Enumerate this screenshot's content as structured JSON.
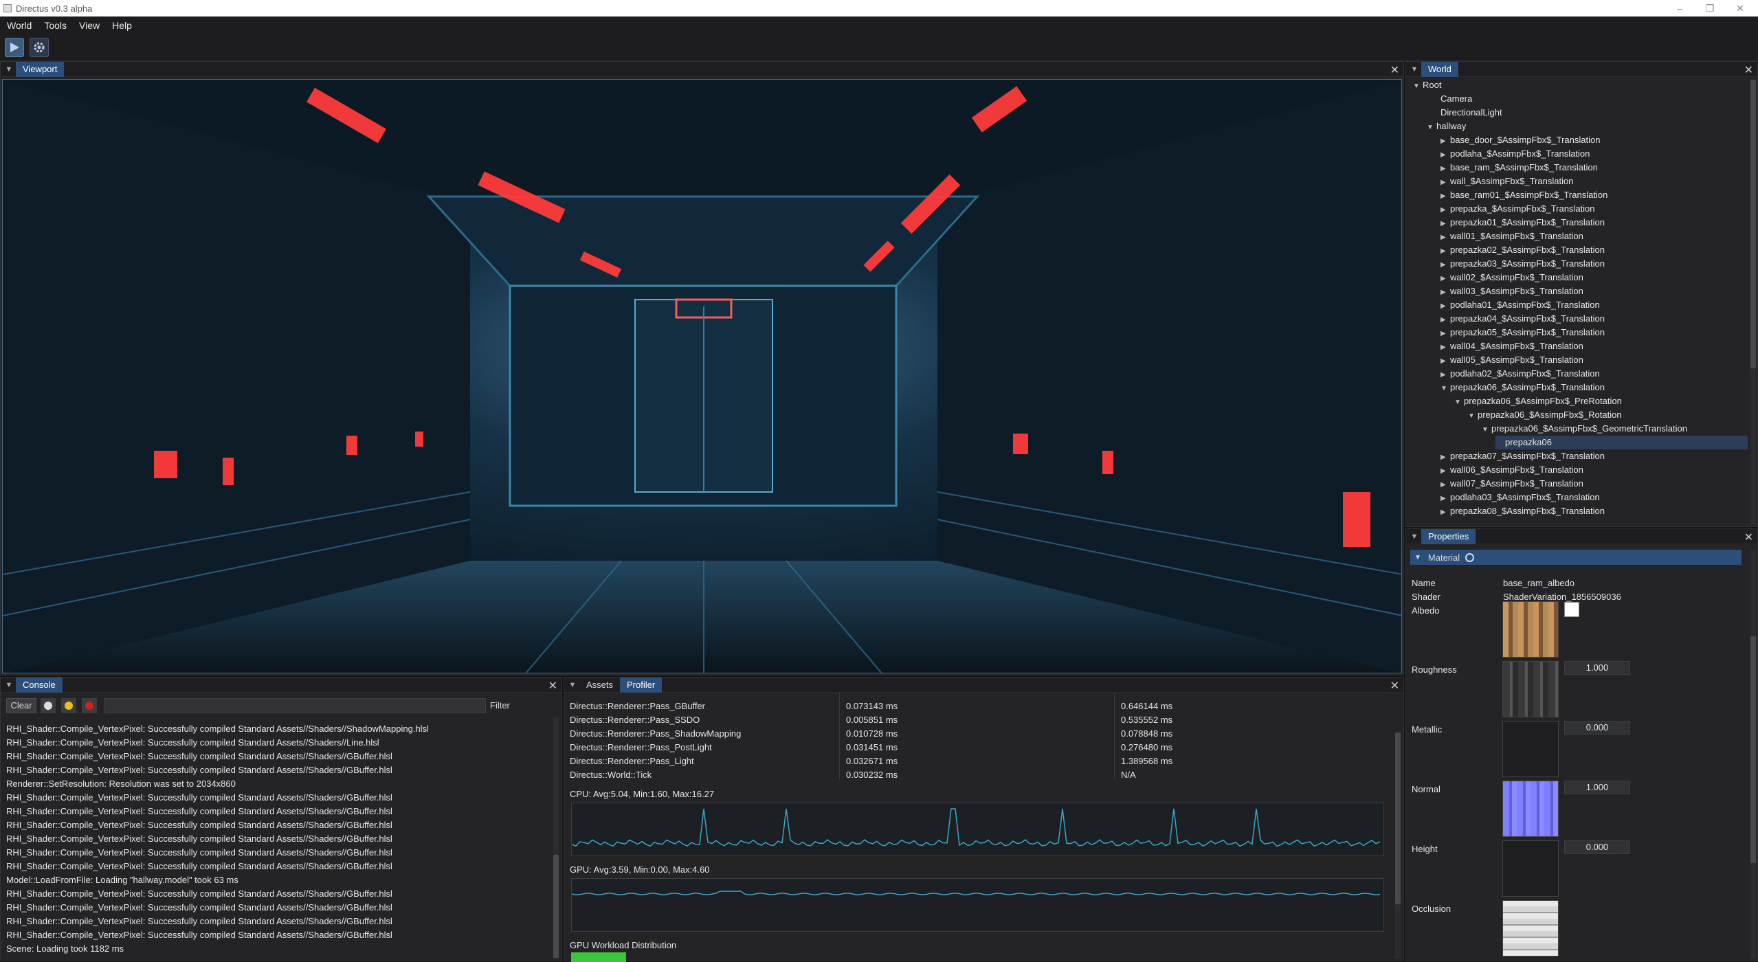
{
  "window": {
    "title": "Directus v0.3 alpha"
  },
  "menubar": {
    "items": [
      "World",
      "Tools",
      "View",
      "Help"
    ]
  },
  "viewport": {
    "tab": "Viewport"
  },
  "world": {
    "tab": "World",
    "nodes": [
      {
        "label": "Root",
        "arrow": "▼"
      },
      {
        "label": "Camera",
        "arrow": ""
      },
      {
        "label": "DirectionalLight",
        "arrow": ""
      },
      {
        "label": "hallway",
        "arrow": "▼"
      },
      {
        "label": "base_door_$AssimpFbx$_Translation",
        "arrow": "▶"
      },
      {
        "label": "podlaha_$AssimpFbx$_Translation",
        "arrow": "▶"
      },
      {
        "label": "base_ram_$AssimpFbx$_Translation",
        "arrow": "▶"
      },
      {
        "label": "wall_$AssimpFbx$_Translation",
        "arrow": "▶"
      },
      {
        "label": "base_ram01_$AssimpFbx$_Translation",
        "arrow": "▶"
      },
      {
        "label": "prepazka_$AssimpFbx$_Translation",
        "arrow": "▶"
      },
      {
        "label": "prepazka01_$AssimpFbx$_Translation",
        "arrow": "▶"
      },
      {
        "label": "wall01_$AssimpFbx$_Translation",
        "arrow": "▶"
      },
      {
        "label": "prepazka02_$AssimpFbx$_Translation",
        "arrow": "▶"
      },
      {
        "label": "prepazka03_$AssimpFbx$_Translation",
        "arrow": "▶"
      },
      {
        "label": "wall02_$AssimpFbx$_Translation",
        "arrow": "▶"
      },
      {
        "label": "wall03_$AssimpFbx$_Translation",
        "arrow": "▶"
      },
      {
        "label": "podlaha01_$AssimpFbx$_Translation",
        "arrow": "▶"
      },
      {
        "label": "prepazka04_$AssimpFbx$_Translation",
        "arrow": "▶"
      },
      {
        "label": "prepazka05_$AssimpFbx$_Translation",
        "arrow": "▶"
      },
      {
        "label": "wall04_$AssimpFbx$_Translation",
        "arrow": "▶"
      },
      {
        "label": "wall05_$AssimpFbx$_Translation",
        "arrow": "▶"
      },
      {
        "label": "podlaha02_$AssimpFbx$_Translation",
        "arrow": "▶"
      },
      {
        "label": "prepazka06_$AssimpFbx$_Translation",
        "arrow": "▼"
      },
      {
        "label": "prepazka06_$AssimpFbx$_PreRotation",
        "arrow": "▼"
      },
      {
        "label": "prepazka06_$AssimpFbx$_Rotation",
        "arrow": "▼"
      },
      {
        "label": "prepazka06_$AssimpFbx$_GeometricTranslation",
        "arrow": "▼"
      },
      {
        "label": "prepazka06",
        "arrow": ""
      },
      {
        "label": "prepazka07_$AssimpFbx$_Translation",
        "arrow": "▶"
      },
      {
        "label": "wall06_$AssimpFbx$_Translation",
        "arrow": "▶"
      },
      {
        "label": "wall07_$AssimpFbx$_Translation",
        "arrow": "▶"
      },
      {
        "label": "podlaha03_$AssimpFbx$_Translation",
        "arrow": "▶"
      },
      {
        "label": "prepazka08_$AssimpFbx$_Translation",
        "arrow": "▶"
      }
    ]
  },
  "properties": {
    "tab": "Properties",
    "section": "Material",
    "name_label": "Name",
    "name_value": "base_ram_albedo",
    "shader_label": "Shader",
    "shader_value": "ShaderVariation_1856509036",
    "albedo_label": "Albedo",
    "roughness_label": "Roughness",
    "roughness_value": "1.000",
    "metallic_label": "Metallic",
    "metallic_value": "0.000",
    "normal_label": "Normal",
    "normal_value": "1.000",
    "height_label": "Height",
    "height_value": "0.000",
    "occlusion_label": "Occlusion"
  },
  "console": {
    "tab": "Console",
    "clear_label": "Clear",
    "filter_label": "Filter",
    "lines": [
      "RHI_Shader::Compile_VertexPixel: Successfully compiled Standard Assets//Shaders//ShadowMapping.hlsl",
      "RHI_Shader::Compile_VertexPixel: Successfully compiled Standard Assets//Shaders//Line.hlsl",
      "RHI_Shader::Compile_VertexPixel: Successfully compiled Standard Assets//Shaders//GBuffer.hlsl",
      "RHI_Shader::Compile_VertexPixel: Successfully compiled Standard Assets//Shaders//GBuffer.hlsl",
      "Renderer::SetResolution: Resolution was set to 2034x860",
      "RHI_Shader::Compile_VertexPixel: Successfully compiled Standard Assets//Shaders//GBuffer.hlsl",
      "RHI_Shader::Compile_VertexPixel: Successfully compiled Standard Assets//Shaders//GBuffer.hlsl",
      "RHI_Shader::Compile_VertexPixel: Successfully compiled Standard Assets//Shaders//GBuffer.hlsl",
      "RHI_Shader::Compile_VertexPixel: Successfully compiled Standard Assets//Shaders//GBuffer.hlsl",
      "RHI_Shader::Compile_VertexPixel: Successfully compiled Standard Assets//Shaders//GBuffer.hlsl",
      "RHI_Shader::Compile_VertexPixel: Successfully compiled Standard Assets//Shaders//GBuffer.hlsl",
      "Model::LoadFromFile: Loading \"hallway.model\" took 63 ms",
      "RHI_Shader::Compile_VertexPixel: Successfully compiled Standard Assets//Shaders//GBuffer.hlsl",
      "RHI_Shader::Compile_VertexPixel: Successfully compiled Standard Assets//Shaders//GBuffer.hlsl",
      "RHI_Shader::Compile_VertexPixel: Successfully compiled Standard Assets//Shaders//GBuffer.hlsl",
      "RHI_Shader::Compile_VertexPixel: Successfully compiled Standard Assets//Shaders//GBuffer.hlsl",
      "Scene: Loading took 1182 ms"
    ]
  },
  "profiler": {
    "tabs": [
      "Assets",
      "Profiler"
    ],
    "rows": [
      {
        "name": "Directus::Renderer::Pass_GBuffer",
        "cpu": "0.073143 ms",
        "gpu": "0.646144 ms"
      },
      {
        "name": "Directus::Renderer::Pass_SSDO",
        "cpu": "0.005851 ms",
        "gpu": "0.535552 ms"
      },
      {
        "name": "Directus::Renderer::Pass_ShadowMapping",
        "cpu": "0.010728 ms",
        "gpu": "0.078848 ms"
      },
      {
        "name": "Directus::Renderer::Pass_PostLight",
        "cpu": "0.031451 ms",
        "gpu": "0.276480 ms"
      },
      {
        "name": "Directus::Renderer::Pass_Light",
        "cpu": "0.032671 ms",
        "gpu": "1.389568 ms"
      },
      {
        "name": "Directus::World::Tick",
        "cpu": "0.030232 ms",
        "gpu": "N/A"
      }
    ],
    "cpu_label": "CPU: Avg:5.04, Min:1.60, Max:16.27",
    "gpu_label": "GPU: Avg:3.59, Min:0.00, Max:4.60",
    "gpu_workload_label": "GPU Workload Distribution"
  },
  "colors": {
    "accent": "#2b4f7a",
    "graph_line": "#3aa6c8"
  }
}
